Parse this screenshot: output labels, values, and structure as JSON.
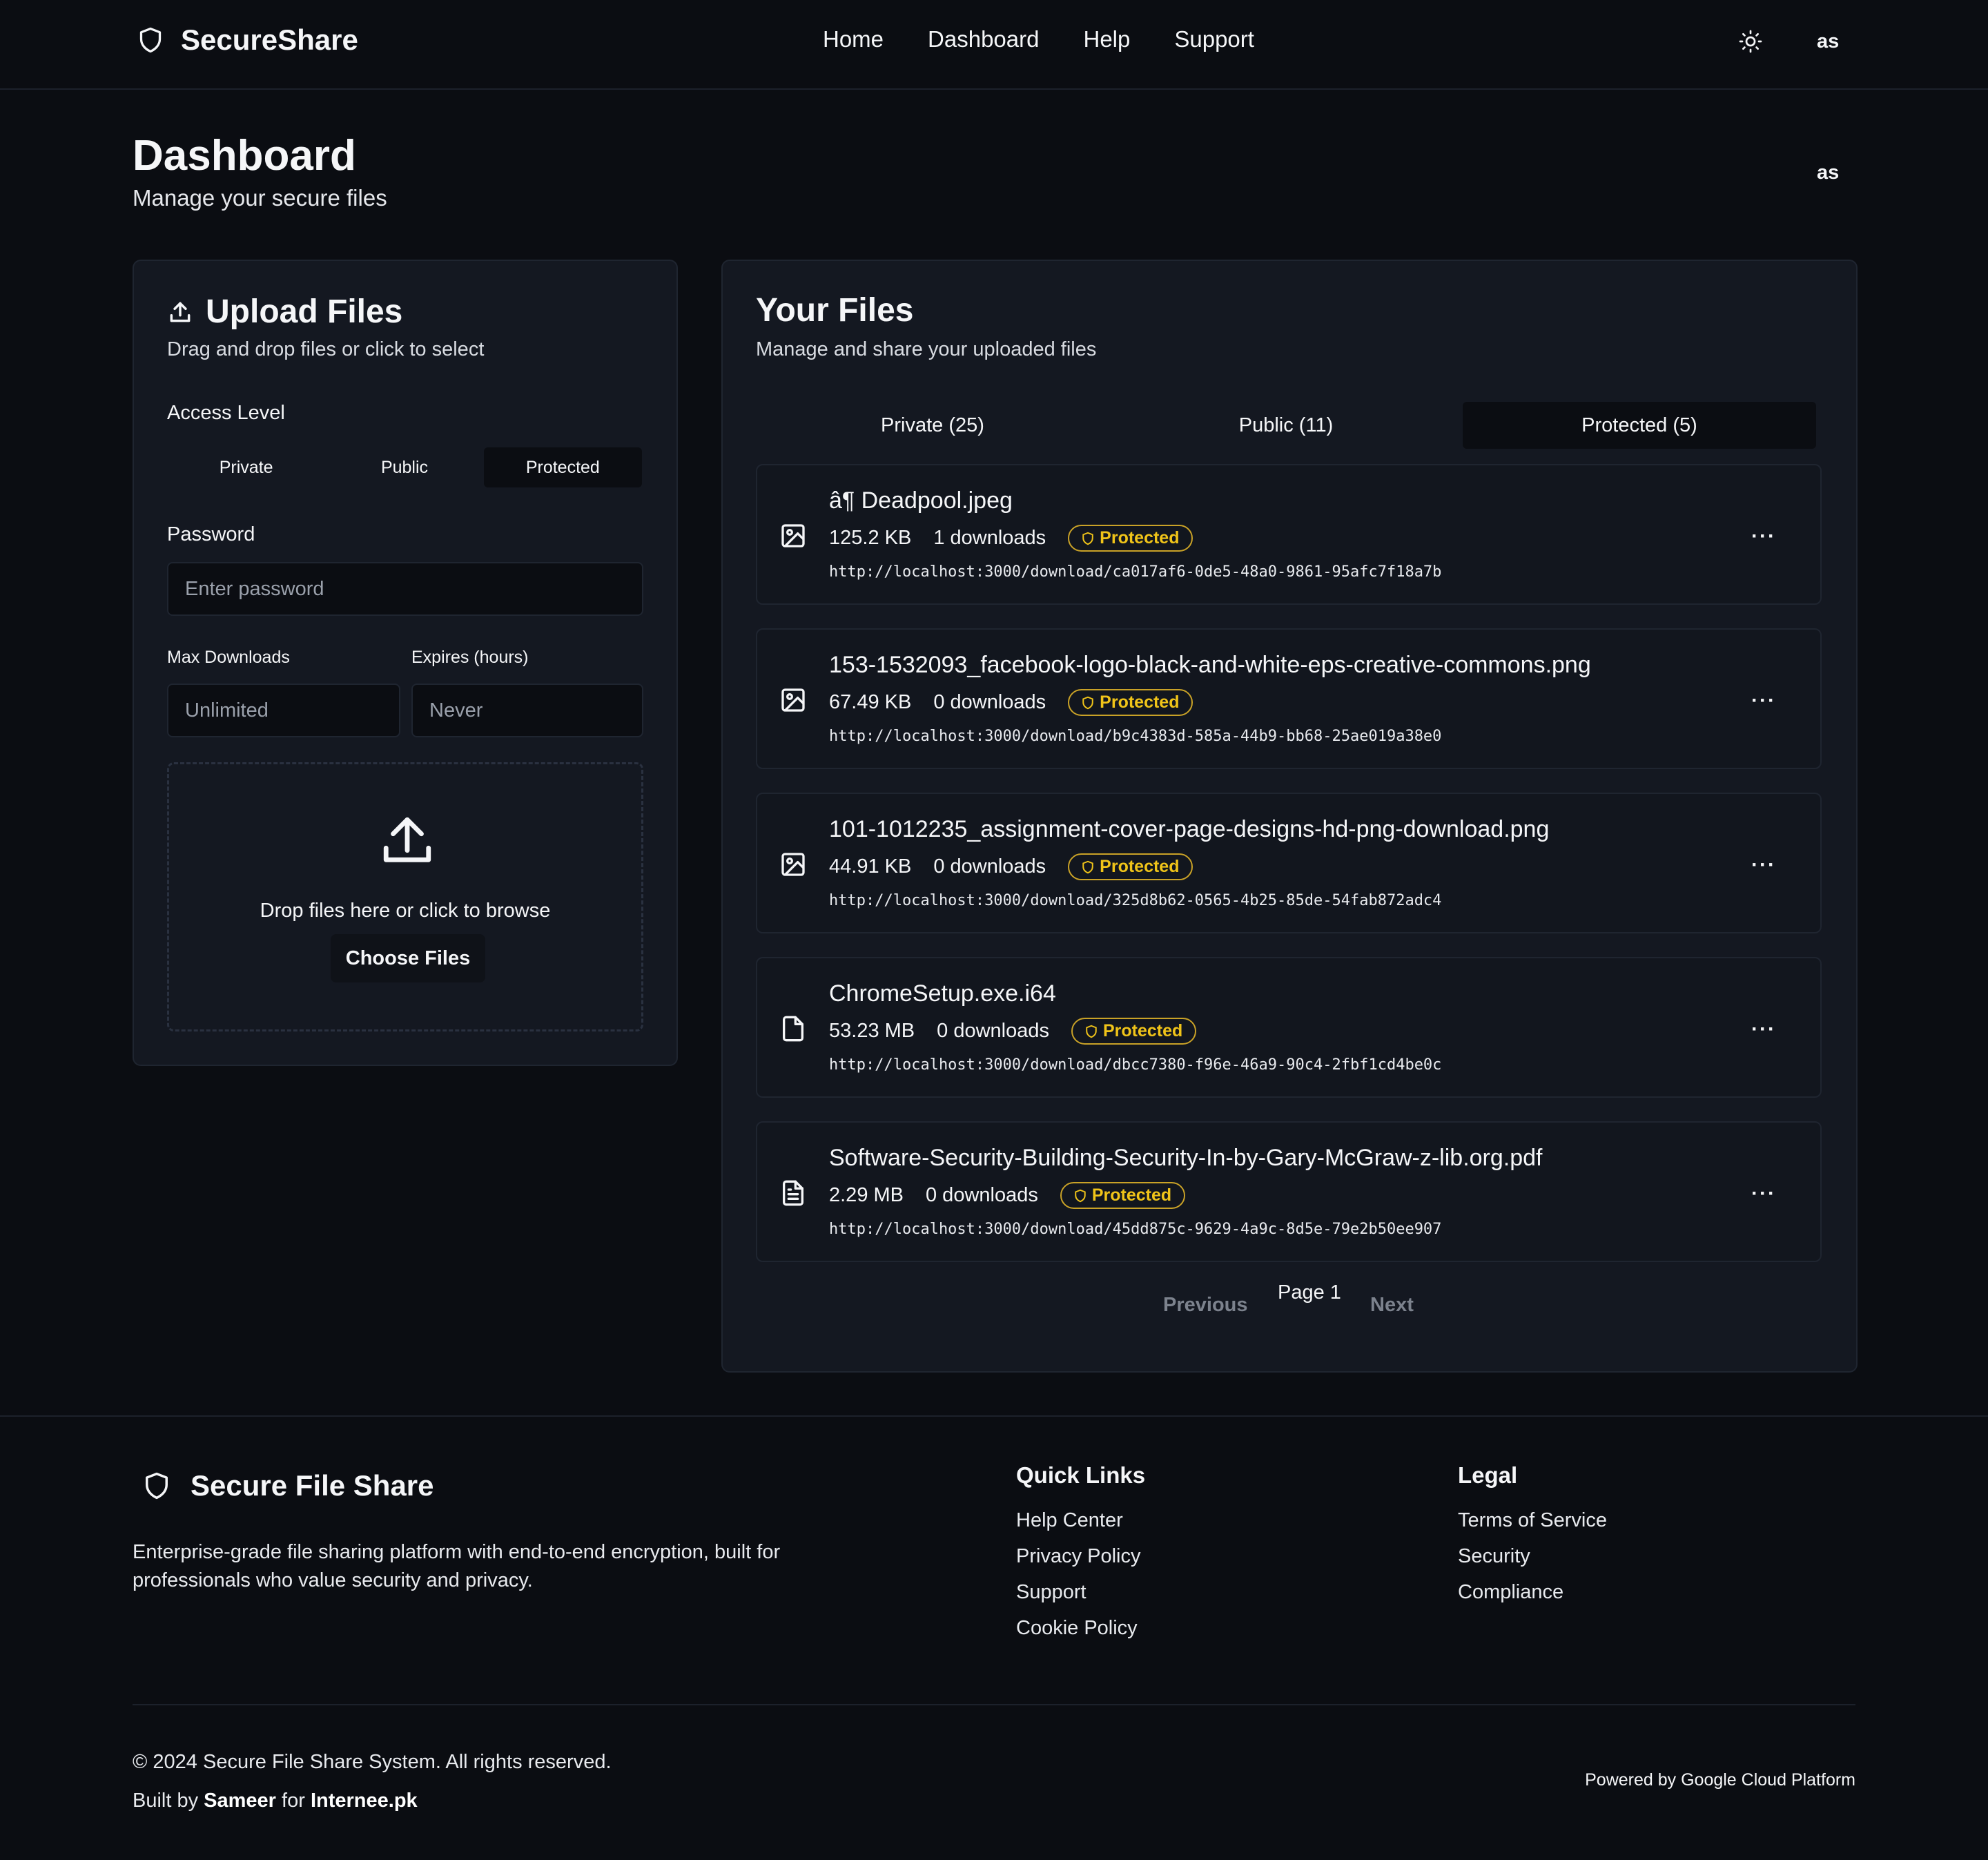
{
  "header": {
    "brand": "SecureShare",
    "nav": [
      "Home",
      "Dashboard",
      "Help",
      "Support"
    ],
    "user": "as"
  },
  "page": {
    "title": "Dashboard",
    "subtitle": "Manage your secure files",
    "user": "as"
  },
  "upload": {
    "title": "Upload Files",
    "subtitle": "Drag and drop files or click to select",
    "access_label": "Access Level",
    "access_options": [
      "Private",
      "Public",
      "Protected"
    ],
    "access_selected": "Protected",
    "password_label": "Password",
    "password_placeholder": "Enter password",
    "max_downloads_label": "Max Downloads",
    "max_downloads_placeholder": "Unlimited",
    "expires_label": "Expires (hours)",
    "expires_placeholder": "Never",
    "drop_text": "Drop files here or click to browse",
    "choose_button": "Choose Files"
  },
  "files": {
    "title": "Your Files",
    "subtitle": "Manage and share your uploaded files",
    "tabs": [
      "Private (25)",
      "Public (11)",
      "Protected (5)"
    ],
    "active_tab": "Protected (5)",
    "items": [
      {
        "name": "â¶ Deadpool.jpeg",
        "size": "125.2 KB",
        "downloads": "1 downloads",
        "badge": "Protected",
        "url": "http://localhost:3000/download/ca017af6-0de5-48a0-9861-95afc7f18a7b",
        "icon": "image-icon"
      },
      {
        "name": "153-1532093_facebook-logo-black-and-white-eps-creative-commons.png",
        "size": "67.49 KB",
        "downloads": "0 downloads",
        "badge": "Protected",
        "url": "http://localhost:3000/download/b9c4383d-585a-44b9-bb68-25ae019a38e0",
        "icon": "image-icon"
      },
      {
        "name": "101-1012235_assignment-cover-page-designs-hd-png-download.png",
        "size": "44.91 KB",
        "downloads": "0 downloads",
        "badge": "Protected",
        "url": "http://localhost:3000/download/325d8b62-0565-4b25-85de-54fab872adc4",
        "icon": "image-icon"
      },
      {
        "name": "ChromeSetup.exe.i64",
        "size": "53.23 MB",
        "downloads": "0 downloads",
        "badge": "Protected",
        "url": "http://localhost:3000/download/dbcc7380-f96e-46a9-90c4-2fbf1cd4be0c",
        "icon": "file-icon"
      },
      {
        "name": "Software-Security-Building-Security-In-by-Gary-McGraw-z-lib.org.pdf",
        "size": "2.29 MB",
        "downloads": "0 downloads",
        "badge": "Protected",
        "url": "http://localhost:3000/download/45dd875c-9629-4a9c-8d5e-79e2b50ee907",
        "icon": "document-icon"
      }
    ],
    "more_label": "···",
    "pager": {
      "previous": "Previous",
      "page": "Page 1",
      "next": "Next"
    }
  },
  "footer": {
    "brand": "Secure File Share",
    "description": "Enterprise-grade file sharing platform with end-to-end encryption, built for professionals who value security and privacy.",
    "quick_links_title": "Quick Links",
    "quick_links": [
      "Help Center",
      "Privacy Policy",
      "Support",
      "Cookie Policy"
    ],
    "legal_title": "Legal",
    "legal_links": [
      "Terms of Service",
      "Security",
      "Compliance"
    ],
    "copyright": "© 2024 Secure File Share System. All rights reserved.",
    "built_prefix": "Built by",
    "built_author": "Sameer",
    "built_mid": "for",
    "built_org": "Internee.pk",
    "powered": "Powered by Google Cloud Platform"
  },
  "colors": {
    "background": "#0b0d12",
    "card": "#141821",
    "badge": "#f0c419"
  }
}
